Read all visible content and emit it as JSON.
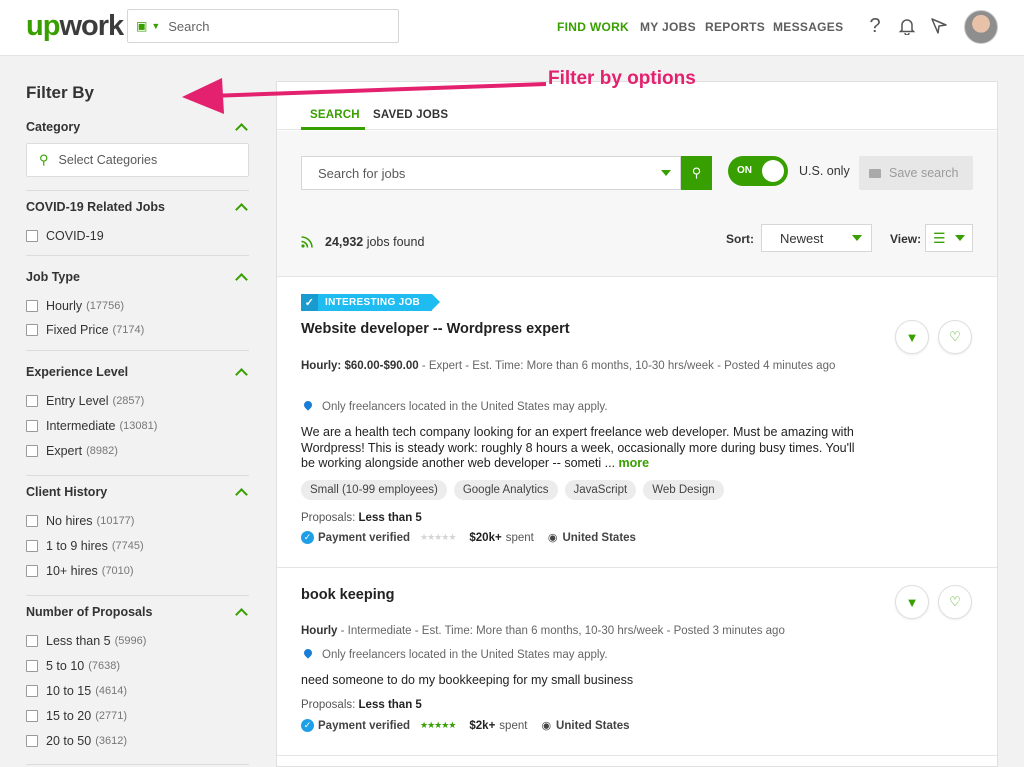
{
  "header": {
    "logo_up": "up",
    "logo_rest": "work",
    "search_placeholder": "Search",
    "nav": [
      "FIND WORK",
      "MY JOBS",
      "REPORTS",
      "MESSAGES"
    ],
    "icons": [
      "help-icon",
      "bell-icon",
      "send-icon"
    ]
  },
  "annotation": "Filter by options",
  "sidebar": {
    "title": "Filter By",
    "category": {
      "title": "Category",
      "placeholder": "Select Categories"
    },
    "covid": {
      "title": "COVID-19 Related Jobs",
      "items": [
        {
          "label": "COVID-19",
          "count": ""
        }
      ]
    },
    "job_type": {
      "title": "Job Type",
      "items": [
        {
          "label": "Hourly",
          "count": "(17756)"
        },
        {
          "label": "Fixed Price",
          "count": "(7174)"
        }
      ]
    },
    "experience": {
      "title": "Experience Level",
      "items": [
        {
          "label": "Entry Level",
          "count": "(2857)"
        },
        {
          "label": "Intermediate",
          "count": "(13081)"
        },
        {
          "label": "Expert",
          "count": "(8982)"
        }
      ]
    },
    "client_history": {
      "title": "Client History",
      "items": [
        {
          "label": "No hires",
          "count": "(10177)"
        },
        {
          "label": "1 to 9 hires",
          "count": "(7745)"
        },
        {
          "label": "10+ hires",
          "count": "(7010)"
        }
      ]
    },
    "proposals": {
      "title": "Number of Proposals",
      "items": [
        {
          "label": "Less than 5",
          "count": "(5996)"
        },
        {
          "label": "5 to 10",
          "count": "(7638)"
        },
        {
          "label": "10 to 15",
          "count": "(4614)"
        },
        {
          "label": "15 to 20",
          "count": "(2771)"
        },
        {
          "label": "20 to 50",
          "count": "(3612)"
        }
      ]
    }
  },
  "main": {
    "tabs": [
      "SEARCH",
      "SAVED JOBS"
    ],
    "search_placeholder": "Search for jobs",
    "toggle_label": "ON",
    "us_only": "U.S. only",
    "save_search": "Save search",
    "jobs_count": "24,932",
    "jobs_found_suffix": " jobs found",
    "sort_label": "Sort:",
    "sort_value": "Newest",
    "view_label": "View:",
    "accent_color": "#37a000",
    "jobs": [
      {
        "badge": "INTERESTING JOB",
        "title": "Website developer -- Wordpress expert",
        "meta_bold": "Hourly: $60.00-$90.00",
        "meta_rest": " - Expert - Est. Time: More than 6 months, 10-30 hrs/week - Posted 4 minutes ago",
        "location_note": "Only freelancers located in the United States may apply.",
        "description": "We are a health tech company looking for an expert freelance web developer. Must be amazing with Wordpress! This is steady work: roughly 8 hours a week, occasionally more during busy times. You'll be working alongside another web developer -- someti ...",
        "more": "more",
        "tags": [
          "Small (10-99 employees)",
          "Google Analytics",
          "JavaScript",
          "Web Design"
        ],
        "proposals_label": "Proposals: ",
        "proposals_value": "Less than 5",
        "payment": "Payment verified",
        "rating": 0,
        "spent_amount": "$20k+",
        "spent_label": "spent",
        "country": "United States"
      },
      {
        "badge": "",
        "title": "book keeping",
        "meta_bold": "Hourly",
        "meta_rest": " - Intermediate - Est. Time: More than 6 months, 10-30 hrs/week - Posted 3 minutes ago",
        "location_note": "Only freelancers located in the United States may apply.",
        "description": "need someone to do my bookkeeping for my small business",
        "more": "",
        "tags": [],
        "proposals_label": "Proposals: ",
        "proposals_value": "Less than 5",
        "payment": "Payment verified",
        "rating": 4.5,
        "spent_amount": "$2k+",
        "spent_label": "spent",
        "country": "United States"
      }
    ]
  }
}
